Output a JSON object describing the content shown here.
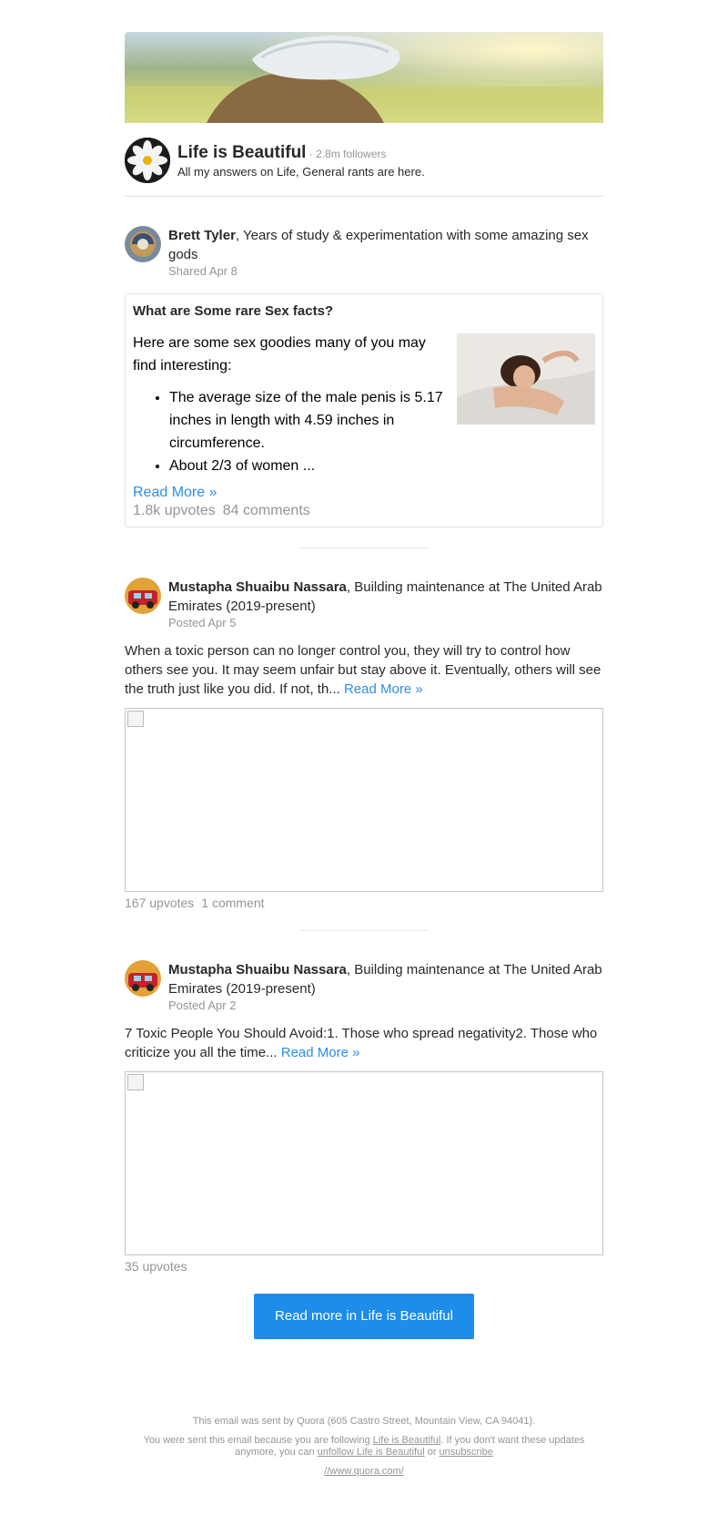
{
  "space": {
    "title": "Life is Beautiful",
    "followers": " · 2.8m followers",
    "description": "All my answers on Life, General rants are here."
  },
  "story1": {
    "author": "Brett Tyler",
    "credential": ", Years of study & experimentation with some amazing sex gods",
    "meta": "Shared Apr 8",
    "question": "What are Some rare Sex facts?",
    "intro": "Here are some sex goodies many of you may find interesting:",
    "bullets": [
      "The average size of the male penis is 5.17 inches in length with 4.59 inches in circumference.",
      "About 2/3 of women ..."
    ],
    "read_more": "Read More »",
    "upvotes": "1.8k upvotes",
    "comments": "84 comments"
  },
  "story2": {
    "author": "Mustapha Shuaibu Nassara",
    "credential": ", Building maintenance at The United Arab Emirates (2019-present)",
    "meta": "Posted Apr 5",
    "text": "When a toxic person can no longer control you, they will try to control how others see you. It may seem unfair but stay above it. Eventually, others will see the truth just like you did. If not, th...",
    "read_more": "Read More »",
    "upvotes": "167 upvotes",
    "comments": "1 comment"
  },
  "story3": {
    "author": "Mustapha Shuaibu Nassara",
    "credential": ", Building maintenance at The United Arab Emirates (2019-present)",
    "meta": "Posted Apr 2",
    "text": "7 Toxic People You Should Avoid:1. Those who spread negativity2. Those who criticize you all the time...",
    "read_more": "Read More »",
    "upvotes": "35 upvotes"
  },
  "cta": {
    "label": "Read more in Life is Beautiful"
  },
  "footer": {
    "line1": "This email was sent by Quora (605 Castro Street, Mountain View, CA 94041).",
    "line2_a": "You were sent this email because you are following ",
    "line2_link": "Life is Beautiful",
    "line2_b": ". If you don't want these updates anymore, you can ",
    "unfollow_link": "unfollow Life is Beautiful",
    "line2_c": " or ",
    "unsubscribe_link": "unsubscribe",
    "url": "//www.quora.com/"
  },
  "colors": {
    "accent": "#2b8ee6",
    "button": "#1d8cea",
    "muted": "#939598"
  }
}
